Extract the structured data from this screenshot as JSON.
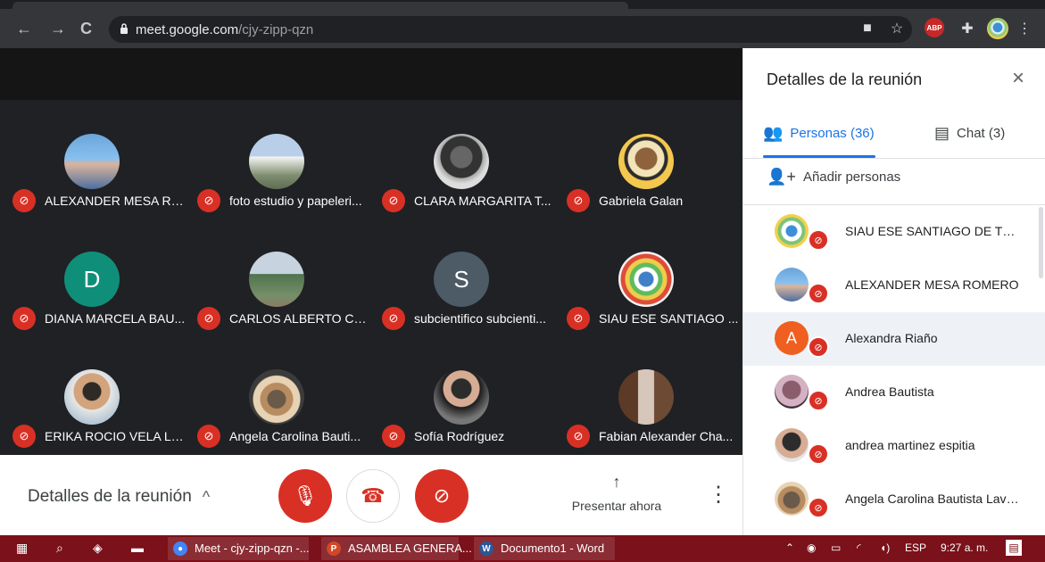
{
  "browser": {
    "url_host": "meet.google.com",
    "url_path": "/cjy-zipp-qzn",
    "nav_back": "←",
    "nav_forward": "→",
    "nav_refresh": "C",
    "extensions": {
      "camera": "■",
      "star": "☆",
      "abp": "ABP",
      "puzzle": "✚",
      "more": "⋮"
    }
  },
  "meet": {
    "tiles": [
      {
        "name": "ALEXANDER MESA RO...",
        "avatar_type": "photo",
        "avatar_key": "p1"
      },
      {
        "name": "foto estudio y papeleri...",
        "avatar_type": "photo",
        "avatar_key": "p2"
      },
      {
        "name": "CLARA MARGARITA T...",
        "avatar_type": "photo",
        "avatar_key": "p3"
      },
      {
        "name": "Gabriela Galan",
        "avatar_type": "photo",
        "avatar_key": "p4"
      },
      {
        "name": "DIANA MARCELA BAU...",
        "avatar_type": "initial",
        "avatar_key": "d",
        "initial": "D"
      },
      {
        "name": "CARLOS ALBERTO CR...",
        "avatar_type": "photo",
        "avatar_key": "p5"
      },
      {
        "name": "subcientifico subcienti...",
        "avatar_type": "initial",
        "avatar_key": "s",
        "initial": "S"
      },
      {
        "name": "SIAU ESE SANTIAGO ...",
        "avatar_type": "photo",
        "avatar_key": "p6"
      },
      {
        "name": "ERIKA ROCIO VELA LO...",
        "avatar_type": "photo",
        "avatar_key": "p7"
      },
      {
        "name": "Angela Carolina Bauti...",
        "avatar_type": "photo",
        "avatar_key": "p8"
      },
      {
        "name": "Sofía Rodríguez",
        "avatar_type": "photo",
        "avatar_key": "p9"
      },
      {
        "name": "Fabian Alexander Cha...",
        "avatar_type": "photo",
        "avatar_key": "p10"
      }
    ],
    "bottom": {
      "details_label": "Detalles de la reunión",
      "chevron": "^",
      "present_label": "Presentar ahora",
      "more": "⋮",
      "present_icon": "↑"
    }
  },
  "panel": {
    "title": "Detalles de la reunión",
    "close": "×",
    "tabs": {
      "people": "Personas (36)",
      "chat": "Chat (3)"
    },
    "add_people": "Añadir personas",
    "participants": [
      {
        "name": "SIAU ESE SANTIAGO DE TUNJ...",
        "avatar_key": "r1"
      },
      {
        "name": "ALEXANDER MESA ROMERO",
        "avatar_key": "r2"
      },
      {
        "name": "Alexandra Riaño",
        "avatar_key": "a",
        "initial": "A"
      },
      {
        "name": "Andrea Bautista",
        "avatar_key": "r3"
      },
      {
        "name": "andrea martinez espitia",
        "avatar_key": "r4"
      },
      {
        "name": "Angela Carolina Bautista Laver...",
        "avatar_key": "r5"
      }
    ]
  },
  "taskbar": {
    "items": [
      {
        "label": "Meet - cjy-zipp-qzn -...",
        "icon_text": "●",
        "icon_color": "#4285f4"
      },
      {
        "label": "ASAMBLEA GENERA...",
        "icon_text": "P",
        "icon_color": "#d24726"
      },
      {
        "label": "Documento1 - Word",
        "icon_text": "W",
        "icon_color": "#2b579a"
      }
    ],
    "tray": {
      "language": "ESP",
      "time": "9:27 a. m."
    }
  }
}
